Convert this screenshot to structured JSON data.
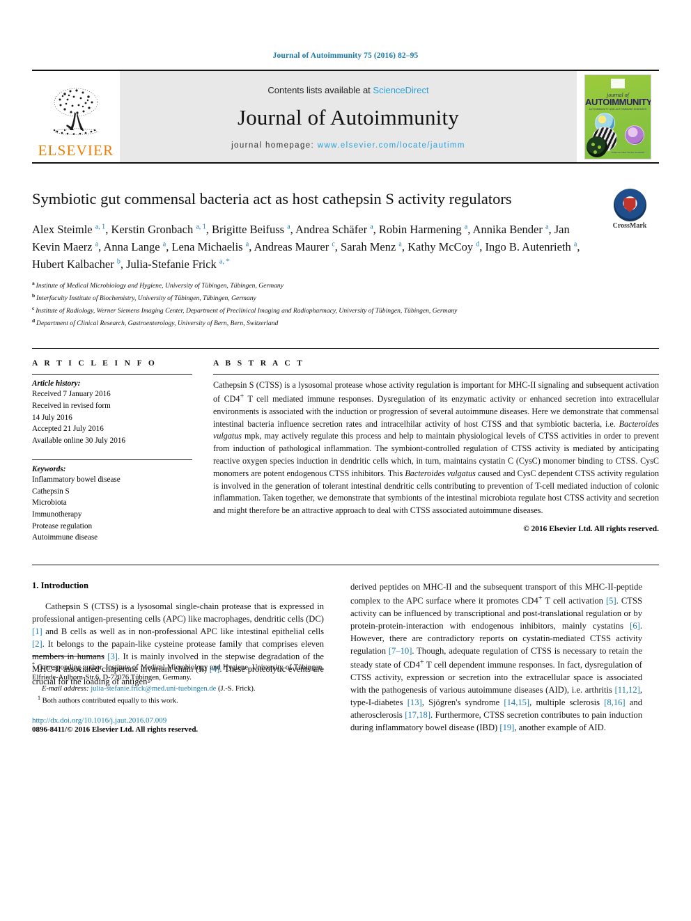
{
  "running_head": "Journal of Autoimmunity 75 (2016) 82–95",
  "masthead": {
    "publisher": "ELSEVIER",
    "contents_prefix": "Contents lists available at ",
    "contents_link": "ScienceDirect",
    "journal_title": "Journal of Autoimmunity",
    "homepage_prefix": "journal homepage: ",
    "homepage_link": "www.elsevier.com/locate/jautimm",
    "cover": {
      "line1": "journal of",
      "line2": "AUTOIMMUNITY",
      "line3": "AUTOIMMUNITY AND AUTOIMMUNE DISEASES",
      "caption": "Editor-in-Chief: M. Eric Gershwin"
    }
  },
  "crossmark": {
    "label": "CrossMark"
  },
  "article": {
    "title": "Symbiotic gut commensal bacteria act as host cathepsin S activity regulators",
    "authors": [
      {
        "name": "Alex Steimle",
        "marks": "a, 1",
        "sep": ", "
      },
      {
        "name": "Kerstin Gronbach",
        "marks": "a, 1",
        "sep": ", "
      },
      {
        "name": "Brigitte Beifuss",
        "marks": "a",
        "sep": ", "
      },
      {
        "name": "Andrea Schäfer",
        "marks": "a",
        "sep": ", "
      },
      {
        "name": "Robin Harmening",
        "marks": "a",
        "sep": ", "
      },
      {
        "name": "Annika Bender",
        "marks": "a",
        "sep": ", "
      },
      {
        "name": "Jan Kevin Maerz",
        "marks": "a",
        "sep": ", "
      },
      {
        "name": "Anna Lange",
        "marks": "a",
        "sep": ", "
      },
      {
        "name": "Lena Michaelis",
        "marks": "a",
        "sep": ", "
      },
      {
        "name": "Andreas Maurer",
        "marks": "c",
        "sep": ", "
      },
      {
        "name": "Sarah Menz",
        "marks": "a",
        "sep": ", "
      },
      {
        "name": "Kathy McCoy",
        "marks": "d",
        "sep": ", "
      },
      {
        "name": "Ingo B. Autenrieth",
        "marks": "a",
        "sep": ", "
      },
      {
        "name": "Hubert Kalbacher",
        "marks": "b",
        "sep": ", "
      },
      {
        "name": "Julia-Stefanie Frick",
        "marks": "a, *",
        "sep": ""
      }
    ],
    "affiliations": [
      {
        "mark": "a",
        "text": "Institute of Medical Microbiology and Hygiene, University of Tübingen, Tübingen, Germany"
      },
      {
        "mark": "b",
        "text": "Interfaculty Institute of Biochemistry, University of Tübingen, Tübingen, Germany"
      },
      {
        "mark": "c",
        "text": "Institute of Radiology, Werner Siemens Imaging Center, Department of Preclinical Imaging and Radiopharmacy, University of Tübingen, Tübingen, Germany"
      },
      {
        "mark": "d",
        "text": "Department of Clinical Research, Gastroenterology, University of Bern, Bern, Switzerland"
      }
    ]
  },
  "info": {
    "heading": "A R T I C L E   I N F O",
    "history_label": "Article history:",
    "history": [
      "Received 7 January 2016",
      "Received in revised form",
      "14 July 2016",
      "Accepted 21 July 2016",
      "Available online 30 July 2016"
    ],
    "keywords_label": "Keywords:",
    "keywords": [
      "Inflammatory bowel disease",
      "Cathepsin S",
      "Microbiota",
      "Immunotherapy",
      "Protease regulation",
      "Autoimmune disease"
    ]
  },
  "abstract": {
    "heading": "A B S T R A C T",
    "body_part1": "Cathepsin S (CTSS) is a lysosomal protease whose activity regulation is important for MHC-II signaling and subsequent activation of CD4",
    "sup1": "+",
    "body_part2": " T cell mediated immune responses. Dysregulation of its enzymatic activity or enhanced secretion into extracellular environments is associated with the induction or progression of several autoimmune diseases. Here we demonstrate that commensal intestinal bacteria influence secretion rates and intracelhilar activity of host CTSS and that symbiotic bacteria, i.e. ",
    "species1": "Bacteroides vulgatus",
    "body_part3": " mpk, may actively regulate this process and help to maintain physiological levels of CTSS activities in order to prevent from induction of pathological inflammation. The symbiont-controlled regulation of CTSS activity is mediated by anticipating reactive oxygen species induction in dendritic cells which, in turn, maintains cystatin C (CysC) monomer binding to CTSS. CysC monomers are potent endogenous CTSS inhibitors. This ",
    "species2": "Bacteroides vulgatus",
    "body_part4": " caused and CysC dependent CTSS activity regulation is involved in the generation of tolerant intestinal dendritic cells contributing to prevention of T-cell mediated induction of colonic inflammation. Taken together, we demonstrate that symbionts of the intestinal microbiota regulate host CTSS activity and secretion and might therefore be an attractive approach to deal with CTSS associated autoimmune diseases.",
    "copyright": "© 2016 Elsevier Ltd. All rights reserved."
  },
  "intro": {
    "heading": "1. Introduction",
    "left_p1_a": "Cathepsin S (CTSS) is a lysosomal single-chain protease that is expressed in professional antigen-presenting cells (APC) like macrophages, dendritic cells (DC) ",
    "cite1": "[1]",
    "left_p1_b": " and B cells as well as in non-professional APC like intestinal epithelial cells ",
    "cite2": "[2]",
    "left_p1_c": ". It belongs to the papain-like cysteine protease family that comprises eleven members in humans ",
    "cite3": "[3]",
    "left_p1_d": ". It is mainly involved in the stepwise degradation of the MHC-II associated chaperone invariant chain (Ii) ",
    "cite4": "[4]",
    "left_p1_e": ". These proteolytic events are crucial for the loading of antigen-",
    "right_a": "derived peptides on MHC-II and the subsequent transport of this MHC-II-peptide complex to the APC surface where it promotes CD4",
    "right_sup1": "+",
    "right_b": " T cell activation ",
    "cite5": "[5]",
    "right_c": ". CTSS activity can be influenced by transcriptional and post-translational regulation or by protein-protein-interaction with endogenous inhibitors, mainly cystatins ",
    "cite6": "[6]",
    "right_d": ". However, there are contradictory reports on cystatin-mediated CTSS activity regulation ",
    "cite7": "[7–10]",
    "right_e": ". Though, adequate regulation of CTSS is necessary to retain the steady state of CD4",
    "right_sup2": "+",
    "right_f": " T cell dependent immune responses. In fact, dysregulation of CTSS activity, expression or secretion into the extracellular space is associated with the pathogenesis of various autoimmune diseases (AID), i.e. arthritis ",
    "cite8": "[11,12]",
    "right_g": ", type-I-diabetes ",
    "cite9": "[13]",
    "right_h": ", Sjögren's syndrome ",
    "cite10": "[14,15]",
    "right_i": ", multiple sclerosis ",
    "cite11": "[8,16]",
    "right_j": " and atherosclerosis ",
    "cite12": "[17,18]",
    "right_k": ". Furthermore, CTSS secretion contributes to pain induction during inflammatory bowel disease (IBD) ",
    "cite13": "[19]",
    "right_l": ", another example of AID."
  },
  "footnotes": {
    "star_mark": "*",
    "corresponding": " Corresponding author. Institute of Medical Microbiology and Hygiene, University of Tübingen, Elfriede-Aulhorn-Str.6, D-72076 Tübingen, Germany.",
    "email_label": "E-mail address:",
    "email": "julia-stefanie.frick@med.uni-tuebingen.de",
    "email_suffix": " (J.-S. Frick).",
    "equal_mark": "1",
    "equal_contrib": " Both authors contributed equally to this work.",
    "doi": "http://dx.doi.org/10.1016/j.jaut.2016.07.009",
    "issn": "0896-8411/© 2016 Elsevier Ltd. All rights reserved."
  }
}
